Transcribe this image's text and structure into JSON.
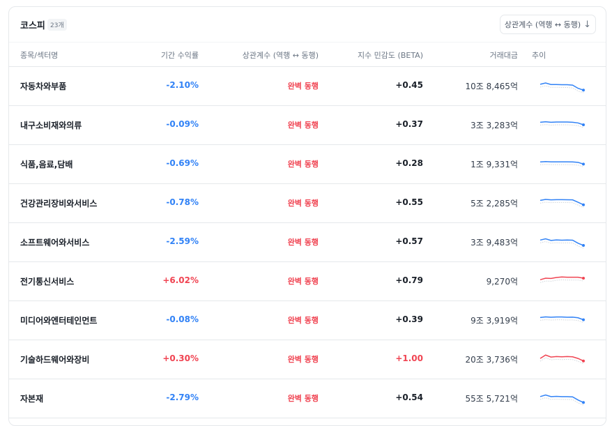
{
  "header": {
    "title": "코스피",
    "count": "23개",
    "sort_label": "상관계수 (역행 ↔ 동행)",
    "sort_icon": "↓"
  },
  "columns": {
    "name": "종목/섹터명",
    "return": "기간 수익률",
    "corr": "상관계수 (역행 ↔ 동행)",
    "beta": "지수 민감도 (BETA)",
    "volume": "거래대금",
    "trend": "추이"
  },
  "colors": {
    "negative": "#3182f6",
    "positive": "#f04452",
    "neutral": "#191f28"
  },
  "rows": [
    {
      "name": "자동차와부품",
      "return": "-2.10%",
      "corr": "완벽 동행",
      "beta": "+0.45",
      "volume": "10조 8,465억",
      "trend": [
        0.62,
        0.72,
        0.6,
        0.6,
        0.58,
        0.58,
        0.55,
        0.3,
        0.15
      ]
    },
    {
      "name": "내구소비재와의류",
      "return": "-0.09%",
      "corr": "완벽 동행",
      "beta": "+0.37",
      "volume": "3조 3,283억",
      "trend": [
        0.7,
        0.74,
        0.7,
        0.72,
        0.72,
        0.72,
        0.7,
        0.65,
        0.5
      ]
    },
    {
      "name": "식품,음료,담배",
      "return": "-0.69%",
      "corr": "완벽 동행",
      "beta": "+0.28",
      "volume": "1조 9,331억",
      "trend": [
        0.65,
        0.68,
        0.66,
        0.66,
        0.66,
        0.66,
        0.65,
        0.62,
        0.48
      ]
    },
    {
      "name": "건강관리장비와서비스",
      "return": "-0.78%",
      "corr": "완벽 동행",
      "beta": "+0.55",
      "volume": "5조 2,285억",
      "trend": [
        0.7,
        0.78,
        0.74,
        0.76,
        0.76,
        0.75,
        0.74,
        0.55,
        0.35
      ]
    },
    {
      "name": "소프트웨어와서비스",
      "return": "-2.59%",
      "corr": "완벽 동행",
      "beta": "+0.57",
      "volume": "3조 9,483억",
      "trend": [
        0.65,
        0.75,
        0.62,
        0.66,
        0.64,
        0.65,
        0.64,
        0.4,
        0.22
      ]
    },
    {
      "name": "전기통신서비스",
      "return": "+6.02%",
      "corr": "완벽 동행",
      "beta": "+0.79",
      "volume": "9,270억",
      "trend": [
        0.6,
        0.72,
        0.7,
        0.78,
        0.82,
        0.8,
        0.8,
        0.8,
        0.72
      ]
    },
    {
      "name": "미디어와엔터테인먼트",
      "return": "-0.08%",
      "corr": "완벽 동행",
      "beta": "+0.39",
      "volume": "9조 3,919억",
      "trend": [
        0.7,
        0.75,
        0.72,
        0.74,
        0.74,
        0.72,
        0.73,
        0.68,
        0.52
      ]
    },
    {
      "name": "기술하드웨어와장비",
      "return": "+0.30%",
      "corr": "완벽 동행",
      "beta": "+1.00",
      "volume": "20조 3,736억",
      "trend": [
        0.55,
        0.82,
        0.66,
        0.7,
        0.68,
        0.7,
        0.68,
        0.55,
        0.35
      ]
    },
    {
      "name": "자본재",
      "return": "-2.79%",
      "corr": "완벽 동행",
      "beta": "+0.54",
      "volume": "55조 5,721억",
      "trend": [
        0.62,
        0.75,
        0.62,
        0.64,
        0.62,
        0.62,
        0.6,
        0.35,
        0.15
      ]
    }
  ]
}
